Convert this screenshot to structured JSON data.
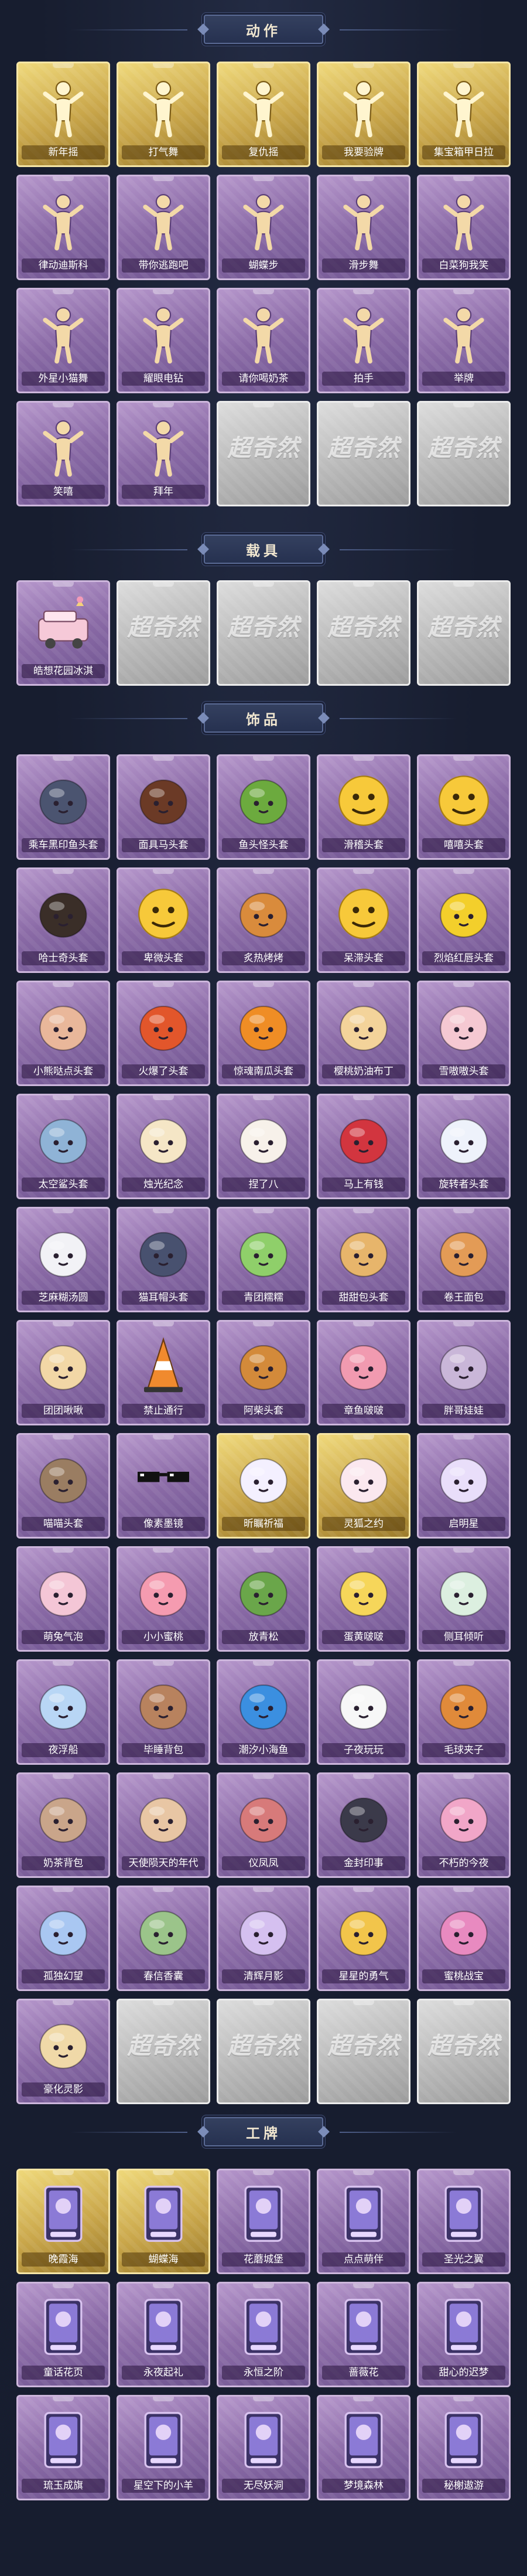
{
  "sections": [
    {
      "title": "动作",
      "items": [
        {
          "label": "新年摇",
          "rarity": "gold",
          "icon": "person-pose-icon"
        },
        {
          "label": "打气舞",
          "rarity": "gold",
          "icon": "person-pose-icon"
        },
        {
          "label": "复仇摇",
          "rarity": "gold",
          "icon": "person-pose-icon"
        },
        {
          "label": "我要验牌",
          "rarity": "gold",
          "icon": "person-pose-icon"
        },
        {
          "label": "集宝箱甲日拉",
          "rarity": "gold",
          "icon": "person-pose-icon"
        },
        {
          "label": "律动迪斯科",
          "rarity": "purple",
          "icon": "person-pose-icon"
        },
        {
          "label": "带你逃跑吧",
          "rarity": "purple",
          "icon": "person-pose-icon"
        },
        {
          "label": "蝴蝶步",
          "rarity": "purple",
          "icon": "person-pose-icon"
        },
        {
          "label": "滑步舞",
          "rarity": "purple",
          "icon": "person-pose-icon"
        },
        {
          "label": "白菜狗我笑",
          "rarity": "purple",
          "icon": "person-pose-icon"
        },
        {
          "label": "外星小猫舞",
          "rarity": "purple",
          "icon": "person-pose-icon"
        },
        {
          "label": "耀眼电钻",
          "rarity": "purple",
          "icon": "person-pose-icon"
        },
        {
          "label": "请你喝奶茶",
          "rarity": "purple",
          "icon": "person-pose-icon"
        },
        {
          "label": "拍手",
          "rarity": "purple",
          "icon": "person-pose-icon"
        },
        {
          "label": "举牌",
          "rarity": "purple",
          "icon": "person-pose-icon"
        },
        {
          "label": "笑嘻",
          "rarity": "purple",
          "icon": "person-pose-icon"
        },
        {
          "label": "拜年",
          "rarity": "purple",
          "icon": "person-pose-icon"
        },
        {
          "label": "",
          "rarity": "gray",
          "icon": "locked-placeholder-icon"
        },
        {
          "label": "",
          "rarity": "gray",
          "icon": "locked-placeholder-icon"
        },
        {
          "label": "",
          "rarity": "gray",
          "icon": "locked-placeholder-icon"
        }
      ]
    },
    {
      "title": "载具",
      "items": [
        {
          "label": "皓想花园冰淇",
          "rarity": "purple",
          "icon": "ice-cream-truck-icon"
        },
        {
          "label": "",
          "rarity": "gray",
          "icon": "locked-placeholder-icon"
        },
        {
          "label": "",
          "rarity": "gray",
          "icon": "locked-placeholder-icon"
        },
        {
          "label": "",
          "rarity": "gray",
          "icon": "locked-placeholder-icon"
        },
        {
          "label": "",
          "rarity": "gray",
          "icon": "locked-placeholder-icon"
        }
      ]
    },
    {
      "title": "饰品",
      "items": [
        {
          "label": "乘车黑印鱼头套",
          "rarity": "purple",
          "icon": "fish-head-icon"
        },
        {
          "label": "面具马头套",
          "rarity": "purple",
          "icon": "horse-head-icon"
        },
        {
          "label": "鱼头怪头套",
          "rarity": "purple",
          "icon": "green-fish-head-icon"
        },
        {
          "label": "滑稽头套",
          "rarity": "purple",
          "icon": "smirk-emoji-icon"
        },
        {
          "label": "嘻嘻头套",
          "rarity": "purple",
          "icon": "grin-emoji-icon"
        },
        {
          "label": "哈士奇头套",
          "rarity": "purple",
          "icon": "husky-head-icon"
        },
        {
          "label": "卑微头套",
          "rarity": "purple",
          "icon": "sad-emoji-icon"
        },
        {
          "label": "炙热烤烤",
          "rarity": "purple",
          "icon": "bread-head-icon"
        },
        {
          "label": "呆滞头套",
          "rarity": "purple",
          "icon": "stare-emoji-icon"
        },
        {
          "label": "烈焰红唇头套",
          "rarity": "purple",
          "icon": "pikachu-head-icon"
        },
        {
          "label": "小熊哒点头套",
          "rarity": "purple",
          "icon": "blob-head-icon"
        },
        {
          "label": "火爆了头套",
          "rarity": "purple",
          "icon": "fire-head-icon"
        },
        {
          "label": "惊魂南瓜头套",
          "rarity": "purple",
          "icon": "pumpkin-head-icon"
        },
        {
          "label": "樱桃奶油布丁",
          "rarity": "purple",
          "icon": "pudding-head-icon"
        },
        {
          "label": "雪嗷嗷头套",
          "rarity": "purple",
          "icon": "snow-pig-head-icon"
        },
        {
          "label": "太空鲨头套",
          "rarity": "purple",
          "icon": "shark-head-icon"
        },
        {
          "label": "烛光纪念",
          "rarity": "purple",
          "icon": "candle-head-icon"
        },
        {
          "label": "捏了八",
          "rarity": "purple",
          "icon": "dumpling-head-icon"
        },
        {
          "label": "马上有钱",
          "rarity": "purple",
          "icon": "red-bird-head-icon"
        },
        {
          "label": "旋转者头套",
          "rarity": "purple",
          "icon": "cloud-head-icon"
        },
        {
          "label": "芝麻糊汤圆",
          "rarity": "purple",
          "icon": "ball-head-icon"
        },
        {
          "label": "猫耳帽头套",
          "rarity": "purple",
          "icon": "cat-head-icon"
        },
        {
          "label": "青团糯糯",
          "rarity": "purple",
          "icon": "green-ball-head-icon"
        },
        {
          "label": "甜甜包头套",
          "rarity": "purple",
          "icon": "bun-head-icon"
        },
        {
          "label": "卷王面包",
          "rarity": "purple",
          "icon": "bread-roll-head-icon"
        },
        {
          "label": "团团啾啾",
          "rarity": "purple",
          "icon": "hamster-head-icon"
        },
        {
          "label": "禁止通行",
          "rarity": "purple",
          "icon": "traffic-cone-icon"
        },
        {
          "label": "阿柴头套",
          "rarity": "purple",
          "icon": "shiba-head-icon"
        },
        {
          "label": "章鱼啵啵",
          "rarity": "purple",
          "icon": "octopus-head-icon"
        },
        {
          "label": "胖哥娃娃",
          "rarity": "purple",
          "icon": "empty-head-icon"
        },
        {
          "label": "喵喵头套",
          "rarity": "purple",
          "icon": "cat-face-icon"
        },
        {
          "label": "像素墨镜",
          "rarity": "purple",
          "icon": "pixel-sunglasses-icon"
        },
        {
          "label": "昕瞩祈福",
          "rarity": "gold",
          "icon": "angel-wings-icon"
        },
        {
          "label": "灵狐之约",
          "rarity": "gold",
          "icon": "fox-ears-icon"
        },
        {
          "label": "启明星",
          "rarity": "purple",
          "icon": "star-crown-icon"
        },
        {
          "label": "萌兔气泡",
          "rarity": "purple",
          "icon": "bunny-bubble-icon"
        },
        {
          "label": "小小蜜桃",
          "rarity": "purple",
          "icon": "peach-icon"
        },
        {
          "label": "放青松",
          "rarity": "purple",
          "icon": "pine-sprout-icon"
        },
        {
          "label": "蛋黄啵啵",
          "rarity": "purple",
          "icon": "egg-yolk-icon"
        },
        {
          "label": "侧耳倾听",
          "rarity": "purple",
          "icon": "flower-hairband-icon"
        },
        {
          "label": "夜浮船",
          "rarity": "purple",
          "icon": "ice-crystal-icon"
        },
        {
          "label": "毕睡背包",
          "rarity": "purple",
          "icon": "bear-backpack-icon"
        },
        {
          "label": "潮汐小海鱼",
          "rarity": "purple",
          "icon": "blue-cat-icon"
        },
        {
          "label": "子夜玩玩",
          "rarity": "purple",
          "icon": "white-bird-icon"
        },
        {
          "label": "毛球夹子",
          "rarity": "purple",
          "icon": "tiger-cub-icon"
        },
        {
          "label": "奶茶背包",
          "rarity": "purple",
          "icon": "tea-backpack-icon"
        },
        {
          "label": "天使陨天的年代",
          "rarity": "purple",
          "icon": "doll-girl-icon"
        },
        {
          "label": "仪凤凤",
          "rarity": "purple",
          "icon": "phoenix-doll-icon"
        },
        {
          "label": "金封印事",
          "rarity": "purple",
          "icon": "chibi-figure-icon"
        },
        {
          "label": "不朽的今夜",
          "rarity": "purple",
          "icon": "pink-charm-icon"
        },
        {
          "label": "孤独幻望",
          "rarity": "purple",
          "icon": "fairy-charm-icon"
        },
        {
          "label": "春信香囊",
          "rarity": "purple",
          "icon": "sachet-icon"
        },
        {
          "label": "清辉月影",
          "rarity": "purple",
          "icon": "bunny-charm-icon"
        },
        {
          "label": "星星的勇气",
          "rarity": "purple",
          "icon": "star-charm-icon"
        },
        {
          "label": "蜜桃战宝",
          "rarity": "purple",
          "icon": "pink-ornament-icon"
        },
        {
          "label": "豪化灵影",
          "rarity": "purple",
          "icon": "angel-charm-icon"
        },
        {
          "label": "",
          "rarity": "gray",
          "icon": "locked-placeholder-icon"
        },
        {
          "label": "",
          "rarity": "gray",
          "icon": "locked-placeholder-icon"
        },
        {
          "label": "",
          "rarity": "gray",
          "icon": "locked-placeholder-icon"
        },
        {
          "label": "",
          "rarity": "gray",
          "icon": "locked-placeholder-icon"
        }
      ]
    },
    {
      "title": "工牌",
      "items": [
        {
          "label": "晚霞海",
          "rarity": "gold",
          "icon": "badge-card-icon"
        },
        {
          "label": "蝴蝶海",
          "rarity": "gold",
          "icon": "badge-card-icon"
        },
        {
          "label": "花蘑城堡",
          "rarity": "purple",
          "icon": "badge-card-icon"
        },
        {
          "label": "点点萌伴",
          "rarity": "purple",
          "icon": "badge-card-icon"
        },
        {
          "label": "圣光之翼",
          "rarity": "purple",
          "icon": "badge-card-icon"
        },
        {
          "label": "童话花页",
          "rarity": "purple",
          "icon": "badge-card-icon"
        },
        {
          "label": "永夜起礼",
          "rarity": "purple",
          "icon": "badge-card-icon"
        },
        {
          "label": "永恒之阶",
          "rarity": "purple",
          "icon": "badge-card-icon"
        },
        {
          "label": "蔷薇花",
          "rarity": "purple",
          "icon": "badge-card-icon"
        },
        {
          "label": "甜心的迟梦",
          "rarity": "purple",
          "icon": "badge-card-icon"
        },
        {
          "label": "琉玉成旗",
          "rarity": "purple",
          "icon": "badge-card-icon"
        },
        {
          "label": "星空下的小羊",
          "rarity": "purple",
          "icon": "badge-card-icon"
        },
        {
          "label": "无尽妖洞",
          "rarity": "purple",
          "icon": "badge-card-icon"
        },
        {
          "label": "梦境森林",
          "rarity": "purple",
          "icon": "badge-card-icon"
        },
        {
          "label": "秘榭遨游",
          "rarity": "purple",
          "icon": "badge-card-icon"
        }
      ]
    }
  ],
  "placeholder_text": "超奇然",
  "colors": {
    "background": "#171d2f",
    "purple_card": "#8a6aa6",
    "gold_card": "#c9a64a",
    "gray_card": "#b7b7b7",
    "header_text": "#f1e7d0"
  }
}
